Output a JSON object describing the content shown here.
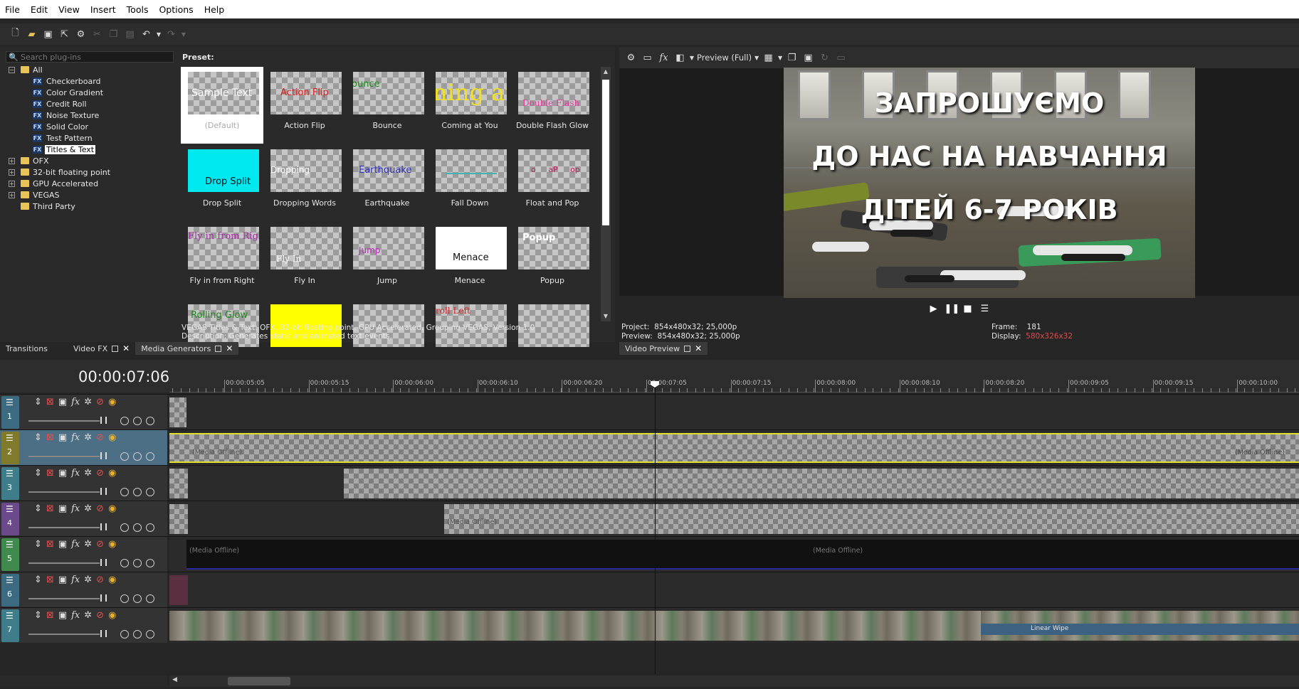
{
  "menu": [
    "File",
    "Edit",
    "View",
    "Insert",
    "Tools",
    "Options",
    "Help"
  ],
  "plugins": {
    "search_placeholder": "Search plug-ins",
    "tree": {
      "all": "All",
      "children": [
        "Checkerboard",
        "Color Gradient",
        "Credit Roll",
        "Noise Texture",
        "Solid Color",
        "Test Pattern",
        "Titles & Text"
      ],
      "groups": [
        "OFX",
        "32-bit floating point",
        "GPU Accelerated",
        "VEGAS",
        "Third Party"
      ]
    }
  },
  "presets": {
    "title": "Preset:",
    "items": [
      {
        "name": "(Default)",
        "thumb": "Sample Text"
      },
      {
        "name": "Action Flip",
        "thumb": "Action Flip"
      },
      {
        "name": "Bounce",
        "thumb": "ounce"
      },
      {
        "name": "Coming at You",
        "thumb": "ning at"
      },
      {
        "name": "Double Flash Glow",
        "thumb": "Double Flash"
      },
      {
        "name": "Drop Split",
        "thumb": "Drop Split"
      },
      {
        "name": "Dropping Words",
        "thumb": "Dropping"
      },
      {
        "name": "Earthquake",
        "thumb": "Earthquake"
      },
      {
        "name": "Fall Down",
        "thumb": ""
      },
      {
        "name": "Float and Pop",
        "thumb": "o aP op"
      },
      {
        "name": "Fly in from Right",
        "thumb": "Fly in from Righ"
      },
      {
        "name": "Fly In",
        "thumb": "Fly In"
      },
      {
        "name": "Jump",
        "thumb": "Jump"
      },
      {
        "name": "Menace",
        "thumb": "Menace"
      },
      {
        "name": "Popup",
        "thumb": "Popup"
      },
      {
        "name": "",
        "thumb": "Rolling Glow"
      },
      {
        "name": "",
        "thumb": ""
      },
      {
        "name": "",
        "thumb": ""
      },
      {
        "name": "",
        "thumb": "roll Left"
      },
      {
        "name": "",
        "thumb": ""
      }
    ],
    "desc1": "VEGAS Titles & Text: OFX, 32-bit floating point, GPU Accelerated, Grouping VEGAS, Version 1.0",
    "desc2": "Description: Generates static and animated text events."
  },
  "tabs": {
    "transitions": "Transitions",
    "videofx": "Video FX",
    "mediagen": "Media Generators",
    "videopreview": "Video Preview"
  },
  "preview": {
    "mode": "Preview (Full)",
    "line1": "ЗАПРОШУЄМО",
    "line2": "ДО НАС НА НАВЧАННЯ",
    "line3": "ДІТЕЙ 6-7 РОКІВ",
    "project_label": "Project:",
    "project_val": "854x480x32; 25,000p",
    "preview_label": "Preview:",
    "preview_val": "854x480x32; 25,000p",
    "frame_label": "Frame:",
    "frame_val": "181",
    "display_label": "Display:",
    "display_val": "580x326x32"
  },
  "timeline": {
    "timecode": "00:00:07:06",
    "ruler": [
      "00:00:05:05",
      "00:00:05:15",
      "00:00:06:00",
      "00:00:06:10",
      "00:00:06:20",
      "00:00:07:05",
      "00:00:07:15",
      "00:00:08:00",
      "00:00:08:10",
      "00:00:08:20",
      "00:00:09:05",
      "00:00:09:15",
      "00:00:10:00"
    ],
    "tracks": [
      "1",
      "2",
      "3",
      "4",
      "5",
      "6",
      "7"
    ],
    "media_offline": "(Media Offline)",
    "linear_wipe": "Linear Wipe"
  },
  "colors": {
    "track1": "#3c6a80",
    "track2": "#7f7a2c",
    "track3": "#3f7d8a",
    "track4": "#6a4a8a",
    "track5": "#3f8a4c",
    "track6": "#3c6a80",
    "track7": "#3f7d8a"
  }
}
